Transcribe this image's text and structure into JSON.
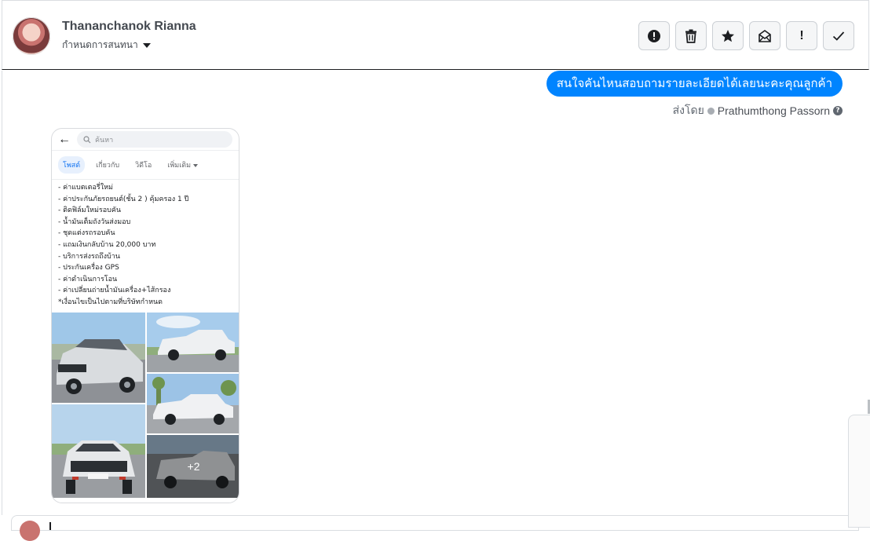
{
  "header": {
    "contact_name": "Thananchanok Rianna",
    "assign_label": "กำหนดการสนทนา",
    "toolbar": [
      {
        "name": "report-spam-button",
        "icon": "alert-circle-icon"
      },
      {
        "name": "delete-button",
        "icon": "trash-icon"
      },
      {
        "name": "star-button",
        "icon": "star-icon"
      },
      {
        "name": "mark-unread-button",
        "icon": "envelope-icon"
      },
      {
        "name": "follow-up-button",
        "icon": "exclamation-icon",
        "text": "!"
      },
      {
        "name": "mark-done-button",
        "icon": "check-icon"
      }
    ]
  },
  "messages": {
    "outgoing_text": "สนใจคันไหนสอบถามรายละเอียดได้เลยนะคะคุณลูกค้า",
    "sent_by_label": "ส่งโดย",
    "agent_name": "Prathumthong Passorn",
    "info_icon": "?"
  },
  "phone_screenshot": {
    "search_placeholder": "ค้นหา",
    "tabs": [
      "โพสต์",
      "เกี่ยวกับ",
      "วิดีโอ",
      "เพิ่มเติม"
    ],
    "list_items": [
      "- ค่าแบตเตอรี่ใหม่",
      "- ค่าประกันภัยรถยนต์(ชั้น 2 ) คุ้มครอง 1 ปี",
      "- ติดฟิล์มใหม่รอบคัน",
      "- น้ำมันเต็มถังวันส่งมอบ",
      "- ชุดแต่งรถรอบคัน",
      "- แถมเงินกลับบ้าน 20,000 บาท",
      "- บริการส่งรถถึงบ้าน",
      "- ประกันเครื่อง GPS",
      "- ค่าดำเนินการโอน",
      "- ค่าเปลี่ยนถ่ายน้ำมันเครื่อง+ไส้กรอง",
      "*เงื่อนไขเป็นไปตามที่บริษัทกำหนด"
    ],
    "more_photos": "+2"
  },
  "colors": {
    "bubble": "#0084ff",
    "border": "#dadde1"
  }
}
